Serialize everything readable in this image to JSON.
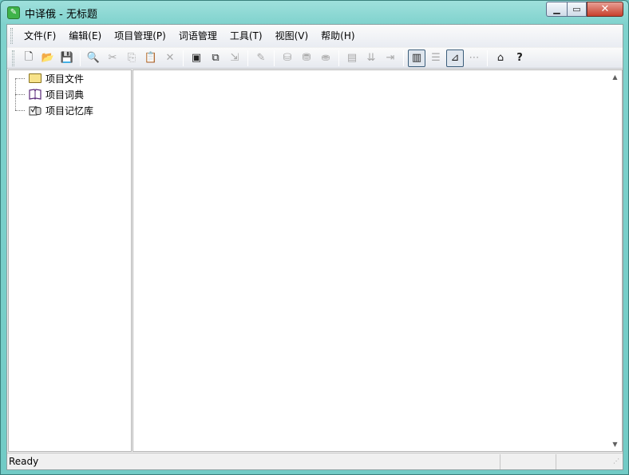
{
  "window": {
    "app_icon": "dict-app-icon",
    "title": "中译俄 - 无标题",
    "min_label": "▁",
    "max_label": "▭",
    "close_label": "✕"
  },
  "menu": [
    {
      "label": "文件(F)"
    },
    {
      "label": "编辑(E)"
    },
    {
      "label": "项目管理(P)"
    },
    {
      "label": "词语管理"
    },
    {
      "label": "工具(T)"
    },
    {
      "label": "视图(V)"
    },
    {
      "label": "帮助(H)"
    }
  ],
  "toolbar": {
    "new_icon": "🗋",
    "open_icon": "📂",
    "save_icon": "💾",
    "find_icon": "🔍",
    "cut_icon": "✂",
    "copy_icon": "⎘",
    "paste_icon": "📋",
    "delete_icon": "✕",
    "add_project_icon": "▣",
    "copy_project_icon": "⧉",
    "export_icon": "⇲",
    "edit_icon": "✎",
    "db_add_icon": "⛁",
    "db_edit_icon": "⛃",
    "db_paste_icon": "⛂",
    "db_icon": "▤",
    "db_import_icon": "⇊",
    "db_export_icon": "⇥",
    "view_tree_icon": "▥",
    "view_list_icon": "☰",
    "view_split_icon": "⊿",
    "view_flow_icon": "⋯",
    "home_icon": "⌂",
    "help_icon": "?"
  },
  "tree": {
    "items": [
      {
        "label": "项目文件",
        "icon": "folder-icon"
      },
      {
        "label": "项目词典",
        "icon": "book-icon"
      },
      {
        "label": "项目记忆库",
        "icon": "memory-icon"
      }
    ]
  },
  "scroll": {
    "up": "▲",
    "down": "▼"
  },
  "status": {
    "text": "Ready",
    "grip": "⋰"
  },
  "colors": {
    "frame": "#72cbc6",
    "close": "#c8402c"
  }
}
